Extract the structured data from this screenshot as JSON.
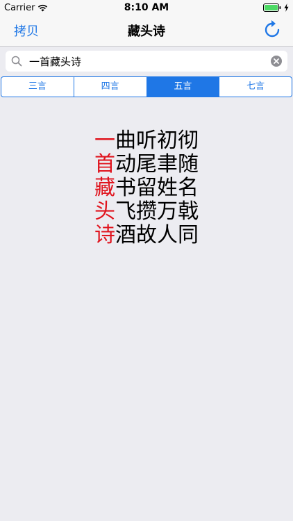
{
  "status_bar": {
    "carrier": "Carrier",
    "time": "8:10 AM"
  },
  "nav": {
    "copy_label": "拷贝",
    "title": "藏头诗"
  },
  "search": {
    "value": "一首藏头诗"
  },
  "segments": [
    {
      "label": "三言",
      "selected": false
    },
    {
      "label": "四言",
      "selected": false
    },
    {
      "label": "五言",
      "selected": true
    },
    {
      "label": "七言",
      "selected": false
    }
  ],
  "poem": {
    "lines": [
      {
        "head": "一",
        "rest": "曲听初彻"
      },
      {
        "head": "首",
        "rest": "动尾聿随"
      },
      {
        "head": "藏",
        "rest": "书留姓名"
      },
      {
        "head": "头",
        "rest": "飞攒万戟"
      },
      {
        "head": "诗",
        "rest": "酒故人同"
      }
    ]
  },
  "colors": {
    "accent": "#1F77E6",
    "head_char": "#E0141E",
    "background": "#ECECF1"
  }
}
